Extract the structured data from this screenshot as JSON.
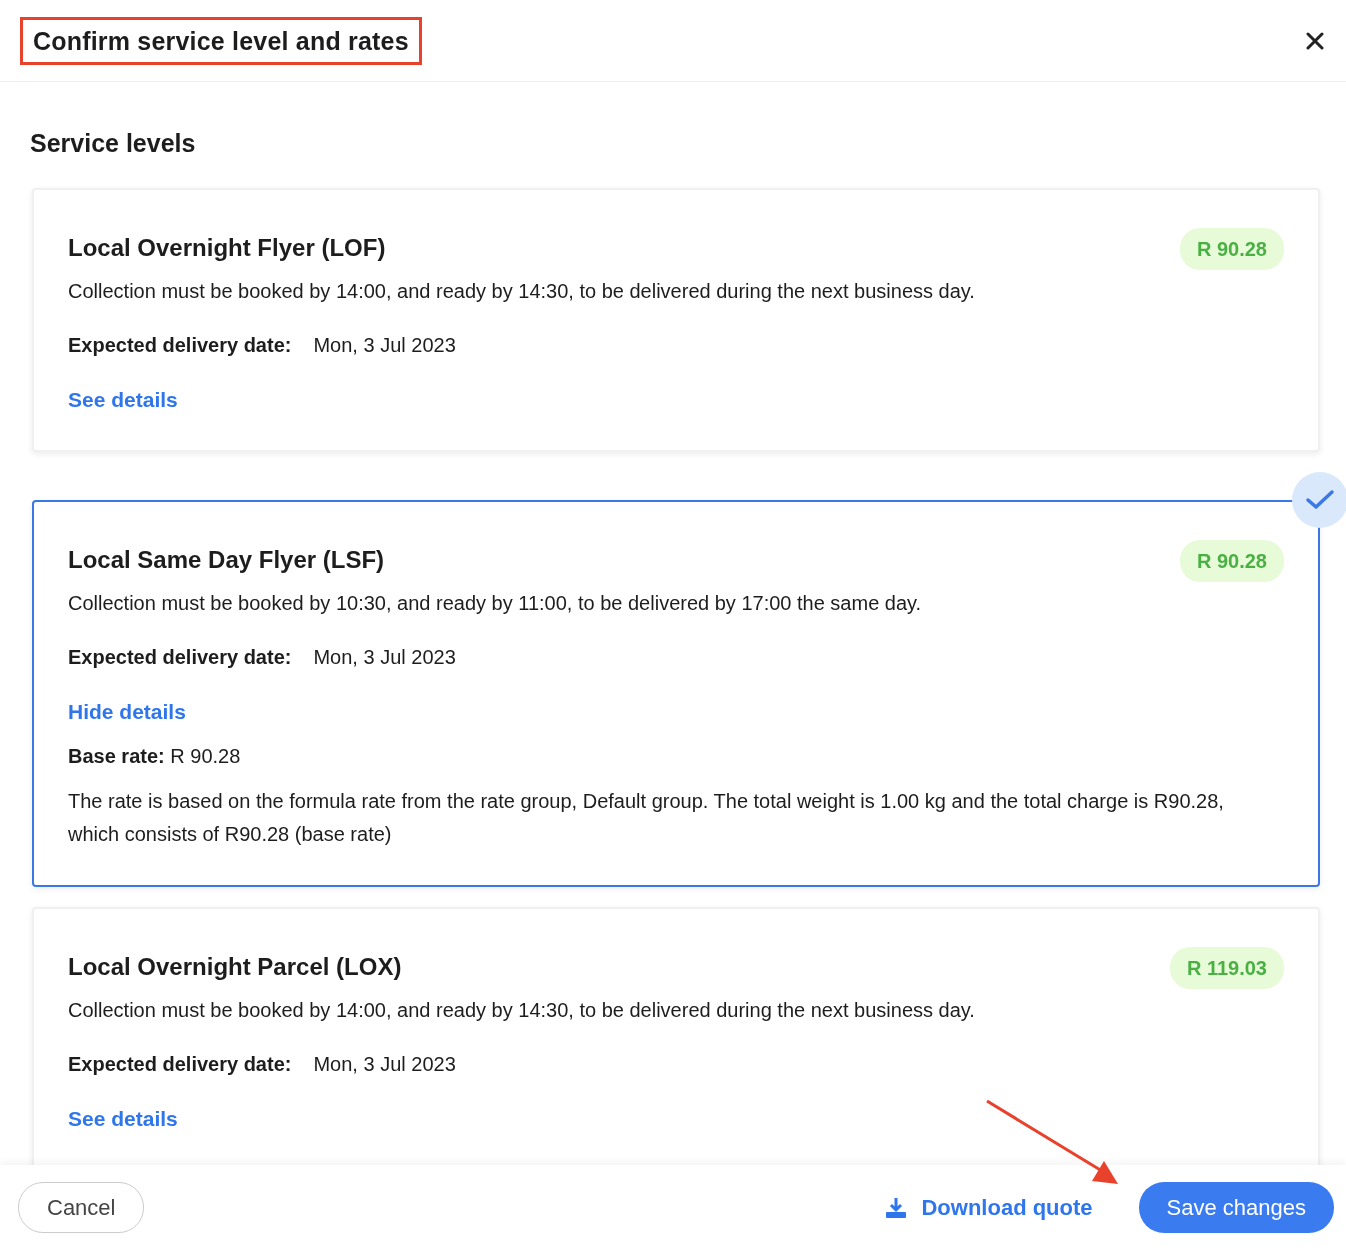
{
  "dialog": {
    "title": "Confirm service level and rates",
    "title_highlighted": true
  },
  "section_title": "Service levels",
  "services": [
    {
      "name": "Local Overnight Flyer (LOF)",
      "price": "R 90.28",
      "description": "Collection must be booked by 14:00, and ready by 14:30, to be delivered during the next business day.",
      "delivery_label": "Expected delivery date:",
      "delivery_date": "Mon, 3 Jul 2023",
      "toggle": "See details",
      "selected": false
    },
    {
      "name": "Local Same Day Flyer (LSF)",
      "price": "R 90.28",
      "description": "Collection must be booked by 10:30, and ready by 11:00, to be delivered by 17:00 the same day.",
      "delivery_label": "Expected delivery date:",
      "delivery_date": "Mon, 3 Jul 2023",
      "toggle": "Hide details",
      "selected": true,
      "details": {
        "base_rate": "**Base rate:** R 90.28",
        "explanation": "The rate is based on the formula rate from the rate group, Default group. The total weight is 1.00 kg and the total charge is R90.28, which consists of R90.28 (base rate)"
      }
    },
    {
      "name": "Local Overnight Parcel (LOX)",
      "price": "R 119.03",
      "description": "Collection must be booked by 14:00, and ready by 14:30, to be delivered during the next business day.",
      "delivery_label": "Expected delivery date:",
      "delivery_date": "Mon, 3 Jul 2023",
      "toggle": "See details",
      "selected": false
    }
  ],
  "footer": {
    "cancel": "Cancel",
    "download": "Download quote",
    "save": "Save changes",
    "save_highlighted": true
  }
}
